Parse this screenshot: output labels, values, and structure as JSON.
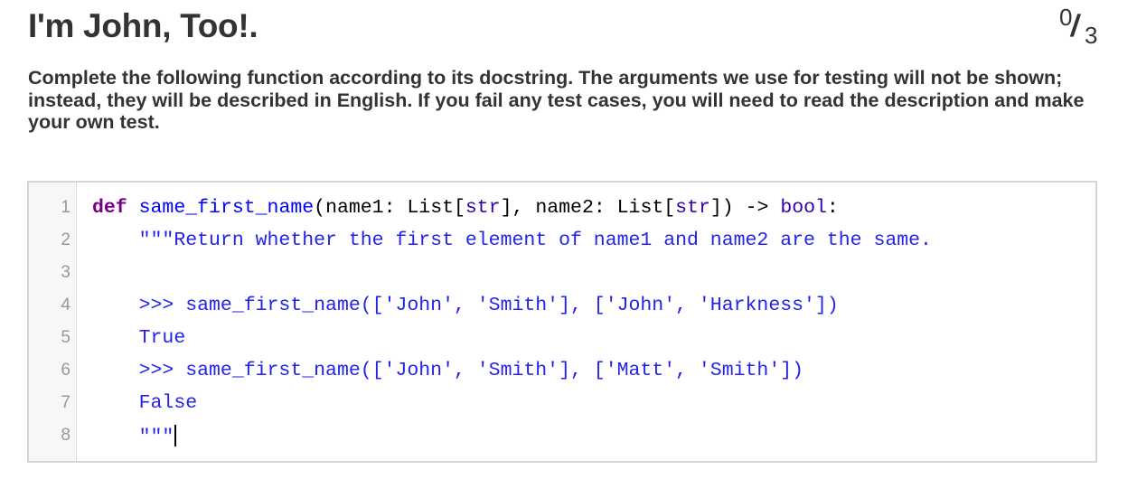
{
  "header": {
    "title": "I'm John, Too!.",
    "score": {
      "earned": "0",
      "total": "3"
    }
  },
  "description": "Complete the following function according to its docstring. The arguments we use for testing will not be shown; instead, they will be described in English. If you fail any test cases, you will need to read the description and make your own test.",
  "editor": {
    "line_numbers": [
      "1",
      "2",
      "3",
      "4",
      "5",
      "6",
      "7",
      "8"
    ],
    "lines": {
      "l1": {
        "kw": "def",
        "fn": "same_first_name",
        "p1": "(name1: List[",
        "t1": "str",
        "p2": "], name2: List[",
        "t2": "str",
        "p3": "]) -> ",
        "ret": "bool",
        "p4": ":"
      },
      "l2": "    \"\"\"Return whether the first element of name1 and name2 are the same.",
      "l3": "",
      "l4": "    >>> same_first_name(['John', 'Smith'], ['John', 'Harkness'])",
      "l5": "    True",
      "l6": "    >>> same_first_name(['John', 'Smith'], ['Matt', 'Smith'])",
      "l7": "    False",
      "l8": "    \"\"\""
    }
  },
  "colors": {
    "keyword": "#770088",
    "function_name": "#0000ff",
    "builtin_type": "#3300aa",
    "docstring": "#2222ee",
    "text": "#333333"
  }
}
